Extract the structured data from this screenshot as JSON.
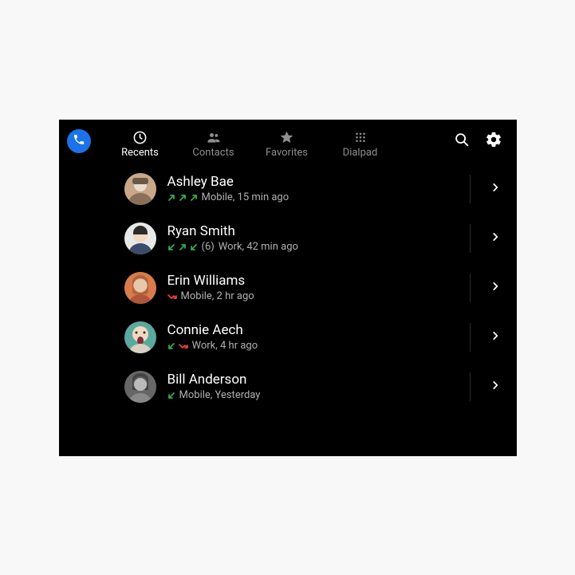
{
  "tabs": [
    {
      "id": "recents",
      "label": "Recents",
      "active": true
    },
    {
      "id": "contacts",
      "label": "Contacts",
      "active": false
    },
    {
      "id": "favorites",
      "label": "Favorites",
      "active": false
    },
    {
      "id": "dialpad",
      "label": "Dialpad",
      "active": false
    }
  ],
  "calls": [
    {
      "name": "Ashley Bae",
      "arrows": [
        "out",
        "out",
        "out"
      ],
      "count": null,
      "line": "Mobile, 15 min ago"
    },
    {
      "name": "Ryan Smith",
      "arrows": [
        "in",
        "out",
        "in"
      ],
      "count": "(6)",
      "line": "Work, 42 min ago"
    },
    {
      "name": "Erin Williams",
      "arrows": [
        "miss"
      ],
      "count": null,
      "line": "Mobile, 2 hr ago"
    },
    {
      "name": "Connie Aech",
      "arrows": [
        "in",
        "miss"
      ],
      "count": null,
      "line": "Work, 4 hr ago"
    },
    {
      "name": "Bill Anderson",
      "arrows": [
        "in"
      ],
      "count": null,
      "line": "Mobile, Yesterday"
    }
  ]
}
